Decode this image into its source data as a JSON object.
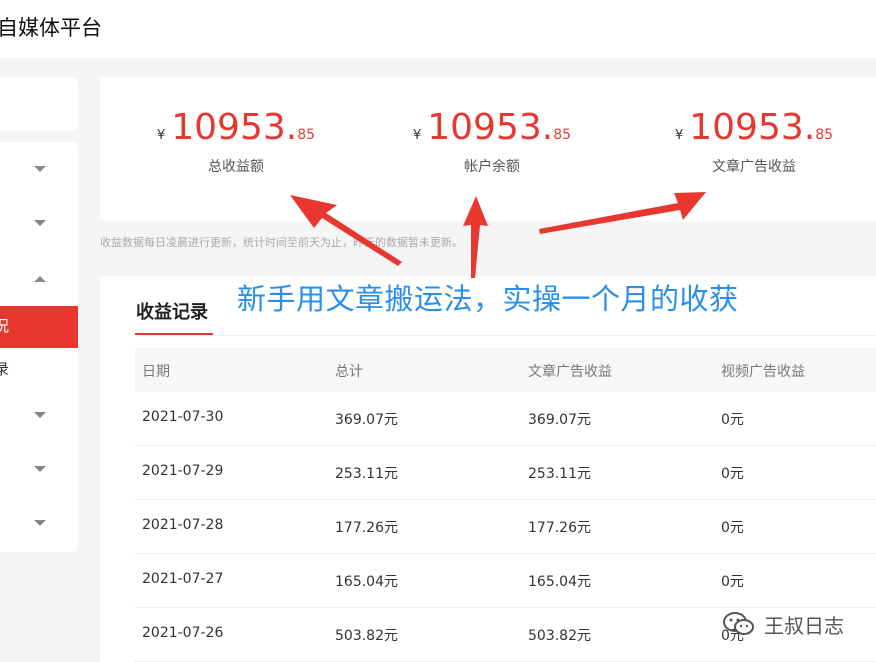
{
  "header": {
    "brand": "自媒体平台"
  },
  "sidebar": {
    "active_item": "况",
    "sub_item": "录"
  },
  "summary": {
    "currency": "¥",
    "stats": [
      {
        "integer": "10953",
        "decimal": "85",
        "label": "总收益额"
      },
      {
        "integer": "10953",
        "decimal": "85",
        "label": "帐户余额"
      },
      {
        "integer": "10953",
        "decimal": "85",
        "label": "文章广告收益"
      }
    ],
    "note": "收益数据每日凌晨进行更新，统计时间至前天为止，昨天的数据暂未更新。"
  },
  "records": {
    "title": "收益记录",
    "columns": [
      "日期",
      "总计",
      "文章广告收益",
      "视频广告收益"
    ],
    "rows": [
      {
        "date": "2021-07-30",
        "total": "369.07元",
        "article": "369.07元",
        "video": "0元"
      },
      {
        "date": "2021-07-29",
        "total": "253.11元",
        "article": "253.11元",
        "video": "0元"
      },
      {
        "date": "2021-07-28",
        "total": "177.26元",
        "article": "177.26元",
        "video": "0元"
      },
      {
        "date": "2021-07-27",
        "total": "165.04元",
        "article": "165.04元",
        "video": "0元"
      },
      {
        "date": "2021-07-26",
        "total": "503.82元",
        "article": "503.82元",
        "video": "0元"
      }
    ]
  },
  "overlay": {
    "caption": "新手用文章搬运法，实操一个月的收获",
    "arrow_color": "#e8372f"
  },
  "watermark": {
    "text": "王叔日志",
    "icon": "wechat-icon"
  },
  "colors": {
    "accent": "#e8372f",
    "caption_blue": "#2a8fe8"
  }
}
